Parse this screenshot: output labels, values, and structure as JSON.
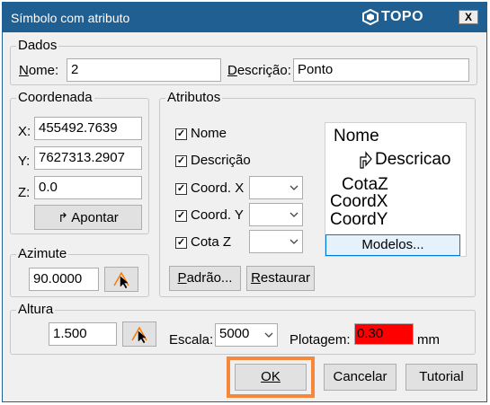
{
  "window": {
    "title": "Símbolo com atributo",
    "brand": "TOPO",
    "close_glyph": "X"
  },
  "dados": {
    "legend": "Dados",
    "nome_label": "Nome:",
    "nome_value": "2",
    "descricao_label": "Descrição:",
    "descricao_value": "Ponto"
  },
  "coordenada": {
    "legend": "Coordenada",
    "x_label": "X:",
    "x_value": "455492.7639",
    "y_label": "Y:",
    "y_value": "7627313.2907",
    "z_label": "Z:",
    "z_value": "0.0",
    "apontar_label": "Apontar"
  },
  "azimute": {
    "legend": "Azimute",
    "value": "90.0000"
  },
  "atributos": {
    "legend": "Atributos",
    "checks": [
      {
        "label": "Nome",
        "checked": true
      },
      {
        "label": "Descrição",
        "checked": true
      },
      {
        "label": "Coord. X",
        "checked": true,
        "combo": ""
      },
      {
        "label": "Coord. Y",
        "checked": true,
        "combo": ""
      },
      {
        "label": "Cota Z",
        "checked": true,
        "combo": ""
      }
    ],
    "check_glyph": "✓",
    "padrao_label": "Padrão...",
    "restaurar_label": "Restaurar",
    "modelos_label": "Modelos...",
    "preview": {
      "nome": "Nome",
      "descricao": "Descricao",
      "cotaz": "CotaZ",
      "coordx": "CoordX",
      "coordy": "CoordY"
    }
  },
  "altura": {
    "legend": "Altura",
    "value": "1.500",
    "escala_label": "Escala:",
    "escala_value": "5000",
    "plotagem_label": "Plotagem:",
    "plotagem_value": "0.30",
    "plotagem_color": "#ff0000",
    "unit": "mm"
  },
  "footer": {
    "ok_label": "OK",
    "cancelar_label": "Cancelar",
    "tutorial_label": "Tutorial",
    "highlight_color": "#f5883a"
  }
}
